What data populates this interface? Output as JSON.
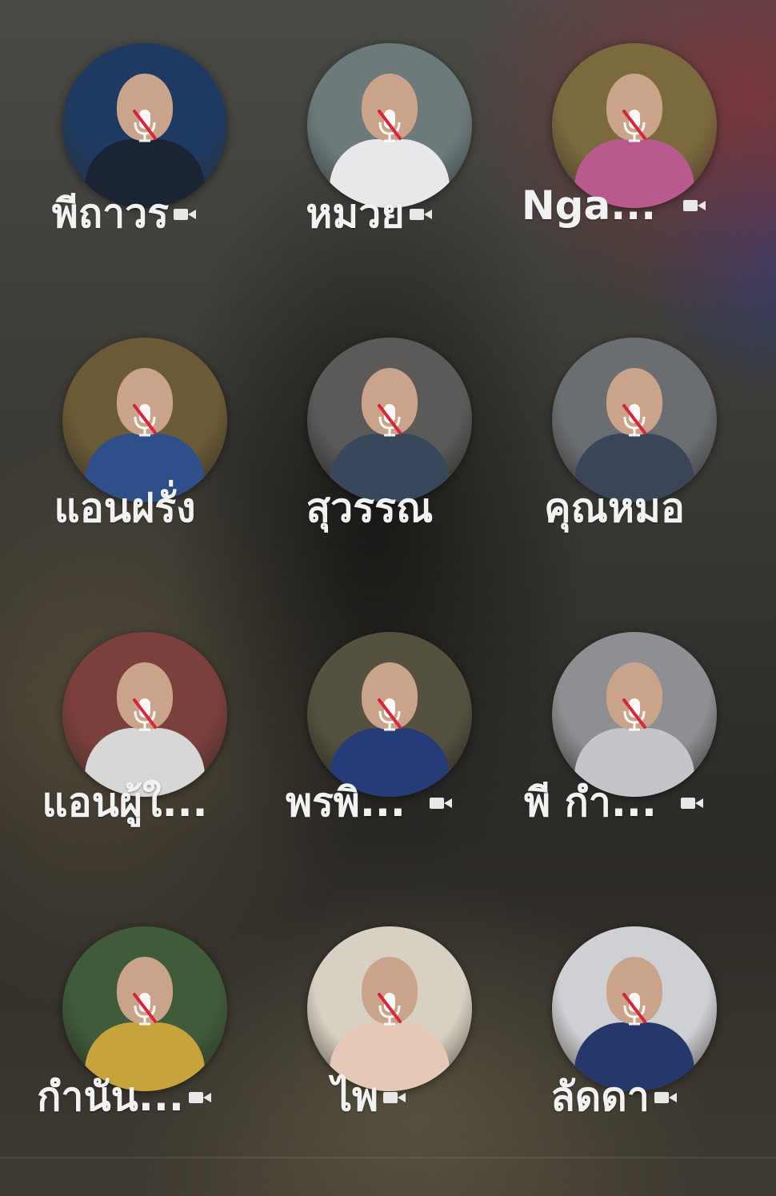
{
  "participants": [
    {
      "name": "พีถาวร",
      "video_icon": true,
      "muted": true,
      "bg": "#1f3a62",
      "body": "#1b2433"
    },
    {
      "name": "หมวย",
      "video_icon": true,
      "muted": true,
      "bg": "#6c7a7c",
      "body": "#e8e8ea"
    },
    {
      "name": "Nga...",
      "video_icon": true,
      "muted": true,
      "bg": "#7a6a3d",
      "body": "#b85a8e"
    },
    {
      "name": "แอนฝรั่ง",
      "video_icon": false,
      "muted": true,
      "bg": "#6b5a36",
      "body": "#2f4f8a"
    },
    {
      "name": "สุวรรณ",
      "video_icon": false,
      "muted": true,
      "bg": "#5c5a58",
      "body": "#39475c"
    },
    {
      "name": "คุณหมอ",
      "video_icon": false,
      "muted": true,
      "bg": "#6b6e71",
      "body": "#3a4658"
    },
    {
      "name": "แอนผู้ใ...",
      "video_icon": false,
      "muted": true,
      "bg": "#7b3f3c",
      "body": "#d7d7d7"
    },
    {
      "name": "พรพิ...",
      "video_icon": true,
      "muted": true,
      "bg": "#54523f",
      "body": "#253c78"
    },
    {
      "name": "พี กำ...",
      "video_icon": true,
      "muted": true,
      "bg": "#8e8f92",
      "body": "#c4c5ca"
    },
    {
      "name": "กำนัน...",
      "video_icon": true,
      "muted": true,
      "bg": "#3f5b3a",
      "body": "#c6a33b"
    },
    {
      "name": "ไพ",
      "video_icon": true,
      "muted": true,
      "bg": "#d8d0c2",
      "body": "#e6c8b6"
    },
    {
      "name": "ลัดดา",
      "video_icon": true,
      "muted": true,
      "bg": "#cfd0d4",
      "body": "#26386b"
    }
  ],
  "icons": {
    "video": "video-camera-icon",
    "muted": "muted-microphone-icon"
  },
  "colors": {
    "name_text": "#f2f2f2",
    "mute_slash": "#d7263d"
  }
}
